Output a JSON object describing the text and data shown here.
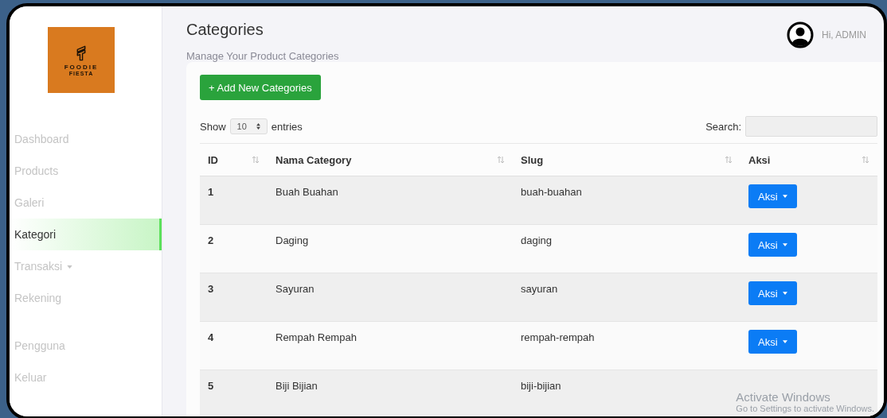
{
  "sidebar": {
    "logo": {
      "title": "FOODIE",
      "subtitle": "FIESTA"
    },
    "groups": [
      {
        "items": [
          {
            "label": "Dashboard",
            "selected": false,
            "kind": "link"
          },
          {
            "label": "Products",
            "selected": false,
            "kind": "link"
          },
          {
            "label": "Galeri",
            "selected": false,
            "kind": "link"
          },
          {
            "label": "Kategori",
            "selected": true,
            "kind": "link"
          },
          {
            "label": "Transaksi",
            "selected": false,
            "kind": "dropdown"
          },
          {
            "label": "Rekening",
            "selected": false,
            "kind": "link"
          }
        ]
      },
      {
        "items": [
          {
            "label": "Pengguna",
            "selected": false,
            "kind": "link"
          },
          {
            "label": "Keluar",
            "selected": false,
            "kind": "link"
          }
        ]
      }
    ]
  },
  "header": {
    "title": "Categories",
    "subtitle": "Manage Your Product Categories",
    "user": "Hi, ADMIN"
  },
  "add_button": "+ Add New Categories",
  "length": {
    "show": "Show",
    "value": "10",
    "entries": "entries"
  },
  "search": {
    "label": "Search:"
  },
  "table": {
    "columns": [
      {
        "label": "ID"
      },
      {
        "label": "Nama Category"
      },
      {
        "label": "Slug"
      },
      {
        "label": "Aksi"
      }
    ],
    "rows": [
      {
        "id": "1",
        "name": "Buah Buahan",
        "slug": "buah-buahan",
        "action": "Aksi"
      },
      {
        "id": "2",
        "name": "Daging",
        "slug": "daging",
        "action": "Aksi"
      },
      {
        "id": "3",
        "name": "Sayuran",
        "slug": "sayuran",
        "action": "Aksi"
      },
      {
        "id": "4",
        "name": "Rempah Rempah",
        "slug": "rempah-rempah",
        "action": "Aksi"
      },
      {
        "id": "5",
        "name": "Biji Bijian",
        "slug": "biji-bijian"
      }
    ]
  },
  "watermark": {
    "title": "Activate Windows",
    "text": "Go to Settings to activate Windows."
  }
}
